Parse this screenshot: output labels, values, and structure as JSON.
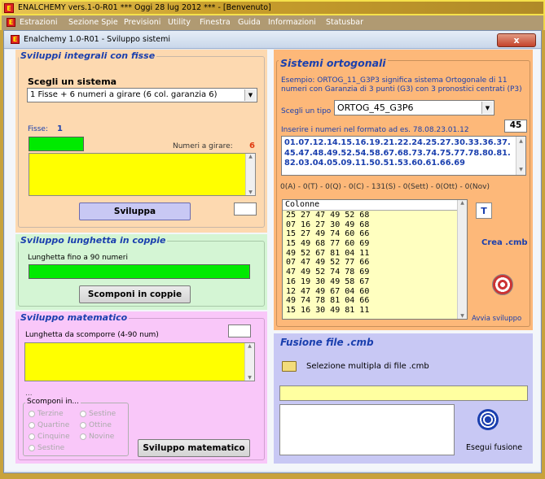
{
  "outer": {
    "title": "ENALCHEMY vers.1-0-R01  ***  Oggi 28 lug 2012  ***   - [Benvenuto]",
    "menu": [
      "Estrazioni",
      "Sezione Spie",
      "Previsioni",
      "Utility",
      "Finestra",
      "Guida",
      "Informazioni",
      "Statusbar"
    ]
  },
  "window": {
    "title": "Enalchemy 1.0-R01 - Sviluppo sistemi",
    "close": "x"
  },
  "integrali": {
    "title": "Sviluppi integrali con fisse",
    "choose_label": "Scegli un sistema",
    "selected_system": "1 Fisse + 6 numeri a girare (6 col. garanzia 6)",
    "fisse_label": "Fisse:",
    "fisse_count": "1",
    "girare_label": "Numeri a girare:",
    "girare_count": "6",
    "button": "Sviluppa"
  },
  "lunghetta": {
    "title": "Sviluppo lunghetta in coppie",
    "label": "Lunghetta fino a 90 numeri",
    "button": "Scomponi in coppie"
  },
  "matematico": {
    "title": "Sviluppo matematico",
    "label": "Lunghetta da scomporre (4-90 num)",
    "dots": "...",
    "scomponi_label": "Scomponi in...",
    "options": [
      "Terzine",
      "Sestine",
      "Quartine",
      "Ottine",
      "Cinquine",
      "Novine",
      "Sestine"
    ],
    "button": "Sviluppo matematico"
  },
  "ortogonali": {
    "title": "Sistemi ortogonali",
    "example": "Esempio: ORTOG_11_G3P3 significa sistema Ortogonale di 11 numeri con Garanzia di 3 punti (G3) con 3 pronostici centrati (P3)",
    "tipo_label": "Scegli un tipo",
    "tipo_value": "ORTOG_45_G3P6",
    "input_label": "Inserire i numeri nel formato ad es. 78.08.23.01.12",
    "count": "45",
    "numbers": "01.07.12.14.15.16.19.21.22.24.25.27.30.33.36.37.45.47.48.49.52.54.58.67.68.73.74.75.77.78.80.81.82.03.04.05.09.11.50.51.53.60.61.66.69",
    "stats": "0(A) - 0(T) - 0(Q) - 0(C) - 131(S) - 0(Sett) - 0(Ott) - 0(Nov)",
    "columns_header": "Colonne",
    "columns": [
      "25 27 47 49 52 68",
      "07 16 27 30 49 68",
      "15 27 49 74 60 66",
      "15 49 68 77 60 69",
      "49 52 67 81 04 11",
      "07 47 49 52 77 66",
      "47 49 52 74 78 69",
      "16 19 30 49 58 67",
      "12 47 49 67 04 60",
      "49 74 78 81 04 66",
      "15 16 30 49 81 11"
    ],
    "crea_label": "Crea .cmb",
    "avvia_label": "Avvia sviluppo"
  },
  "fusione": {
    "title": "Fusione file .cmb",
    "selezione": "Selezione multipla di file .cmb",
    "esegui": "Esegui fusione"
  },
  "colors": {
    "peach": "#fdd9b0",
    "green_panel": "#d4f5d4",
    "pink": "#f9c7f9",
    "orange": "#fdb879",
    "lavender": "#c8c8f4",
    "title_blue": "#1a3fae"
  }
}
